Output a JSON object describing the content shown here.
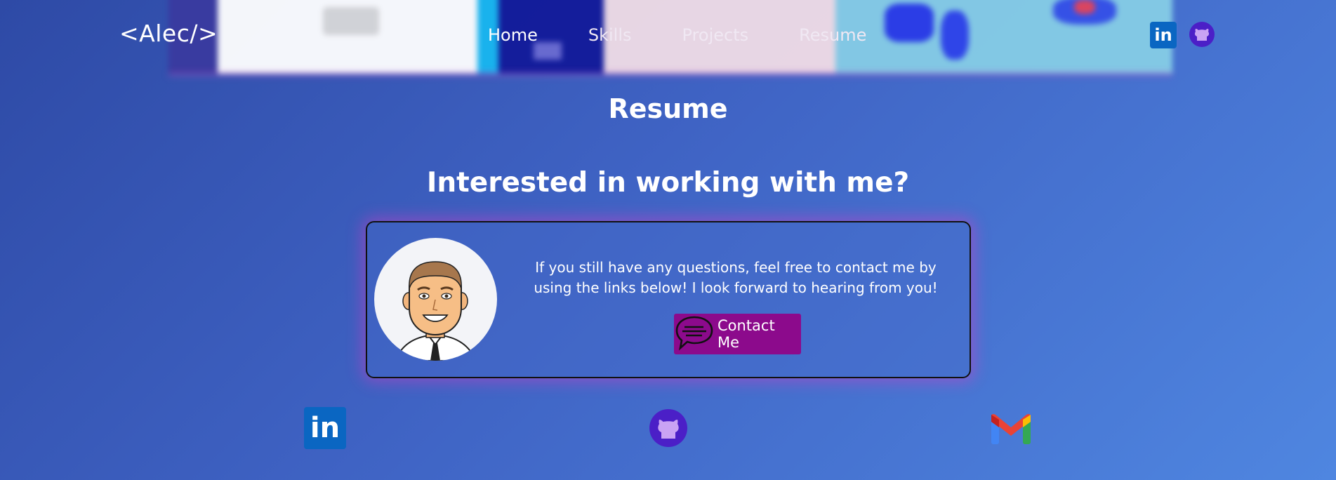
{
  "header": {
    "logo": "<Alec/>",
    "nav": [
      {
        "label": "Home"
      },
      {
        "label": "Skills"
      },
      {
        "label": "Projects"
      },
      {
        "label": "Resume"
      }
    ],
    "social": [
      "linkedin-icon",
      "github-icon"
    ]
  },
  "resume": {
    "title": "Resume"
  },
  "contact": {
    "heading": "Interested in working with me?",
    "message": "If you still have any questions, feel free to contact me by using the links below! I look forward to hearing from you!",
    "button_label": "Contact Me",
    "button_icon": "speech-bubble-icon"
  },
  "footer_social": [
    "linkedin-icon",
    "github-icon",
    "gmail-icon"
  ],
  "colors": {
    "background_start": "#2e4aa6",
    "background_end": "#4f86e0",
    "button": "#8c0a8c",
    "card_glow": "#d23cc8",
    "linkedin": "#0a66c2",
    "github": "#4b1fc7"
  }
}
